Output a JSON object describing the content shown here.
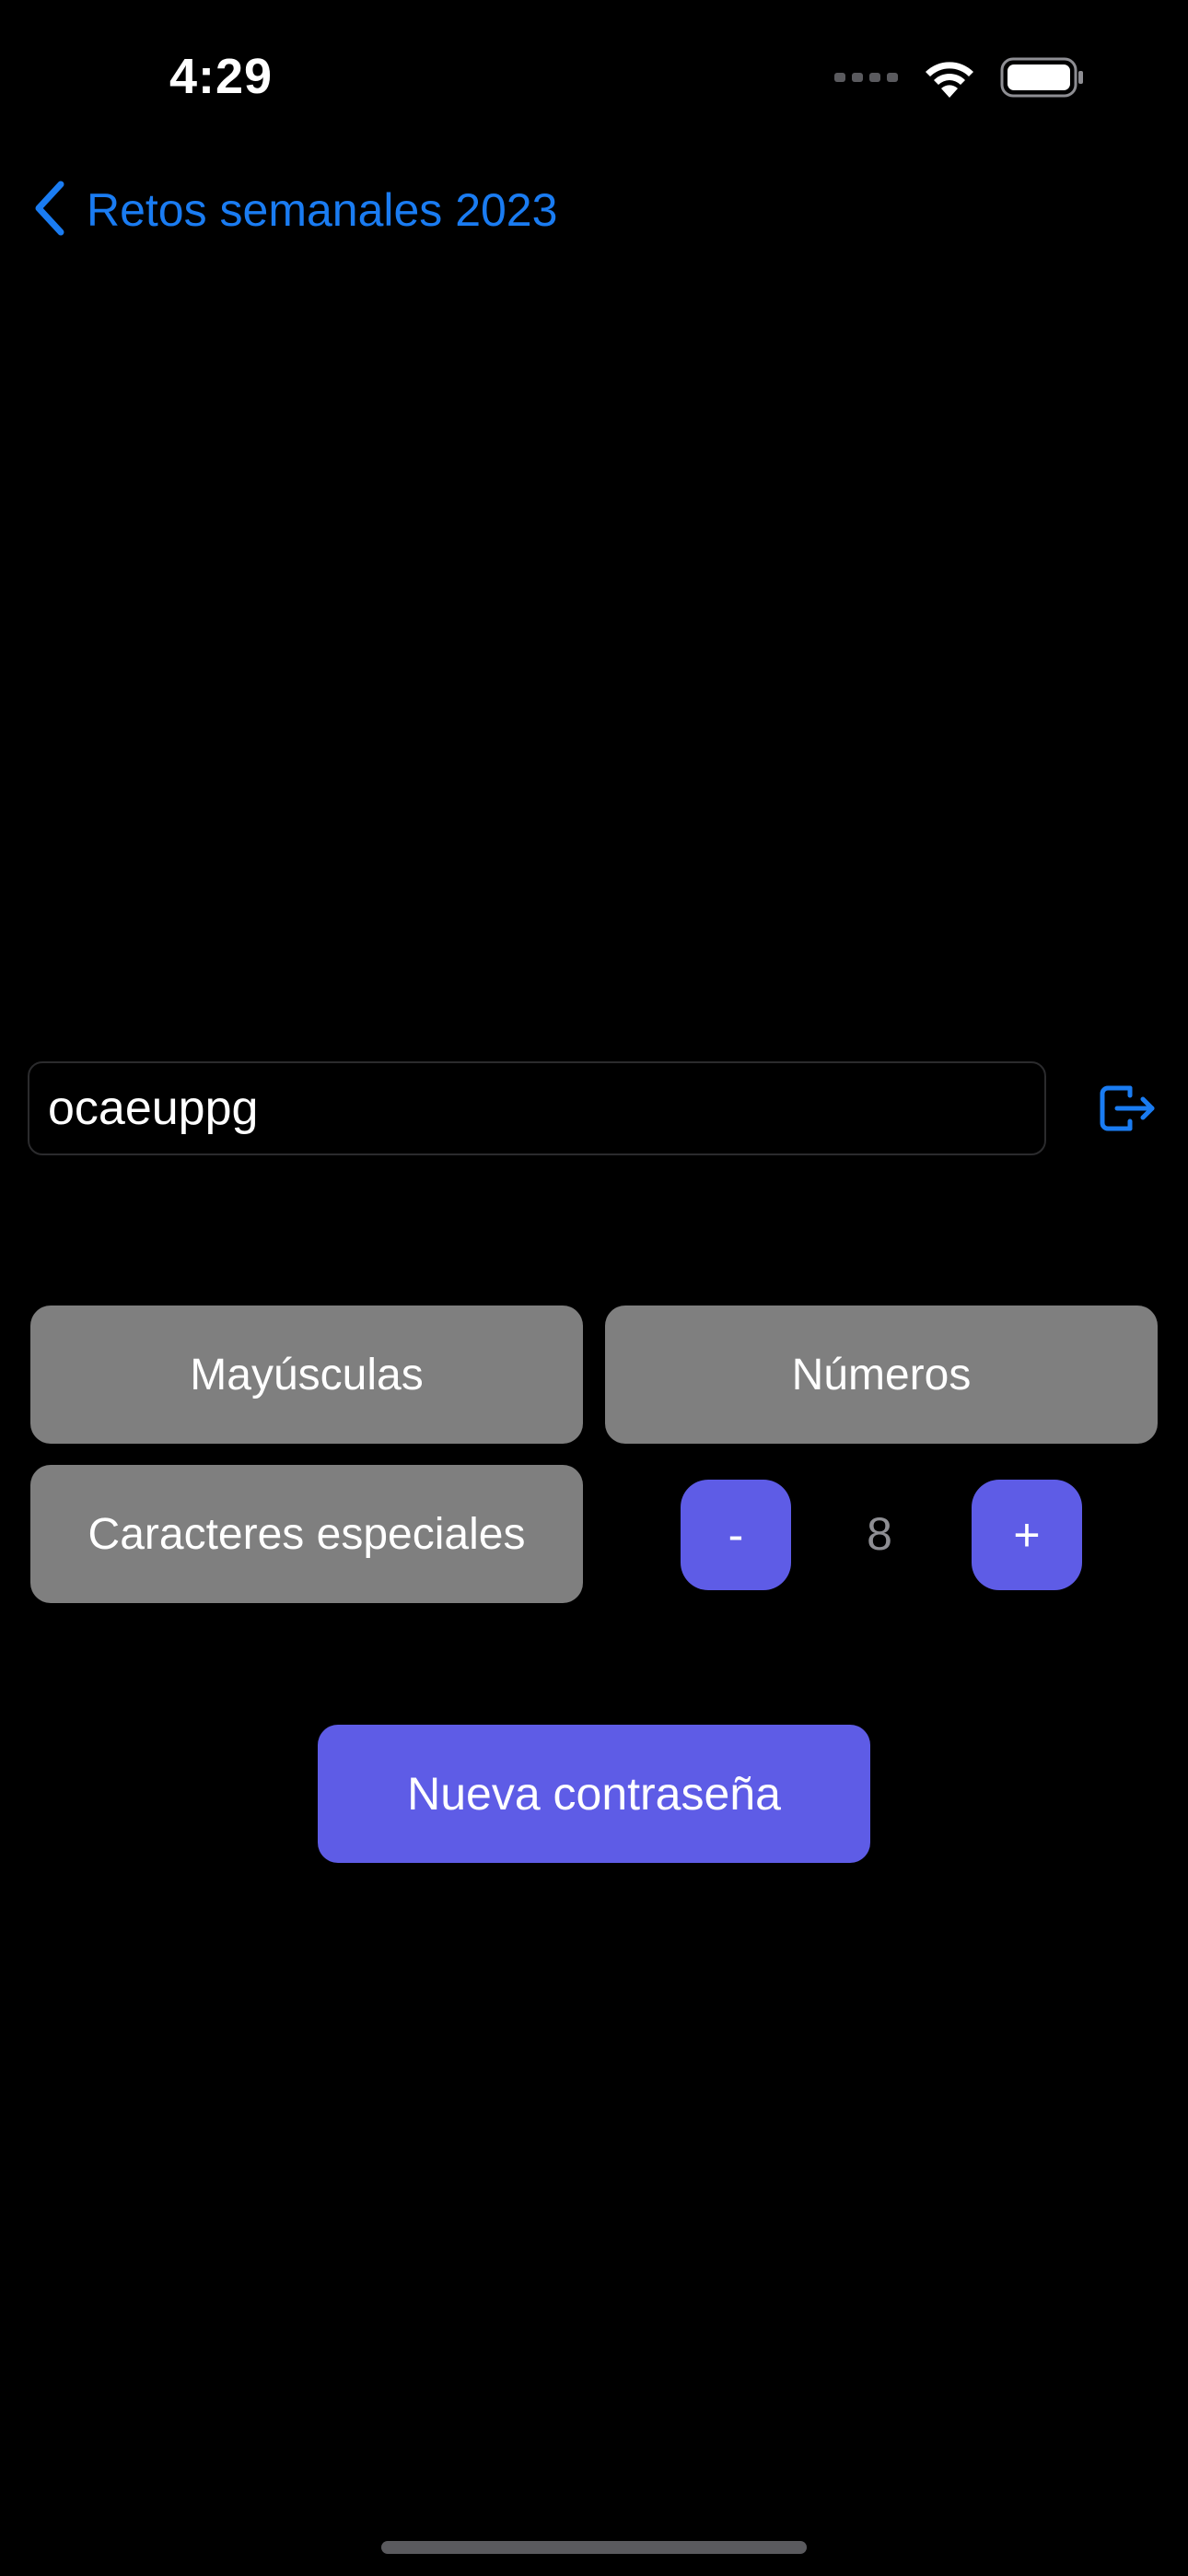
{
  "status_bar": {
    "time": "4:29",
    "icons": [
      "cellular-dots-icon",
      "wifi-icon",
      "battery-icon"
    ]
  },
  "nav": {
    "back_label": "Retos semanales 2023",
    "back_icon": "chevron-left-icon"
  },
  "password": {
    "value": "ocaeuppg",
    "copy_icon": "copy-export-icon"
  },
  "options": {
    "uppercase_label": "Mayúsculas",
    "numbers_label": "Números",
    "special_label": "Caracteres especiales"
  },
  "length": {
    "decrement_label": "-",
    "value": "8",
    "increment_label": "+"
  },
  "actions": {
    "generate_label": "Nueva contraseña"
  },
  "colors": {
    "background": "#000000",
    "accent": "#5e5ce6",
    "link": "#1a7cf2",
    "toggle_off": "#7f7f7f",
    "muted_text": "#8e8e93"
  }
}
